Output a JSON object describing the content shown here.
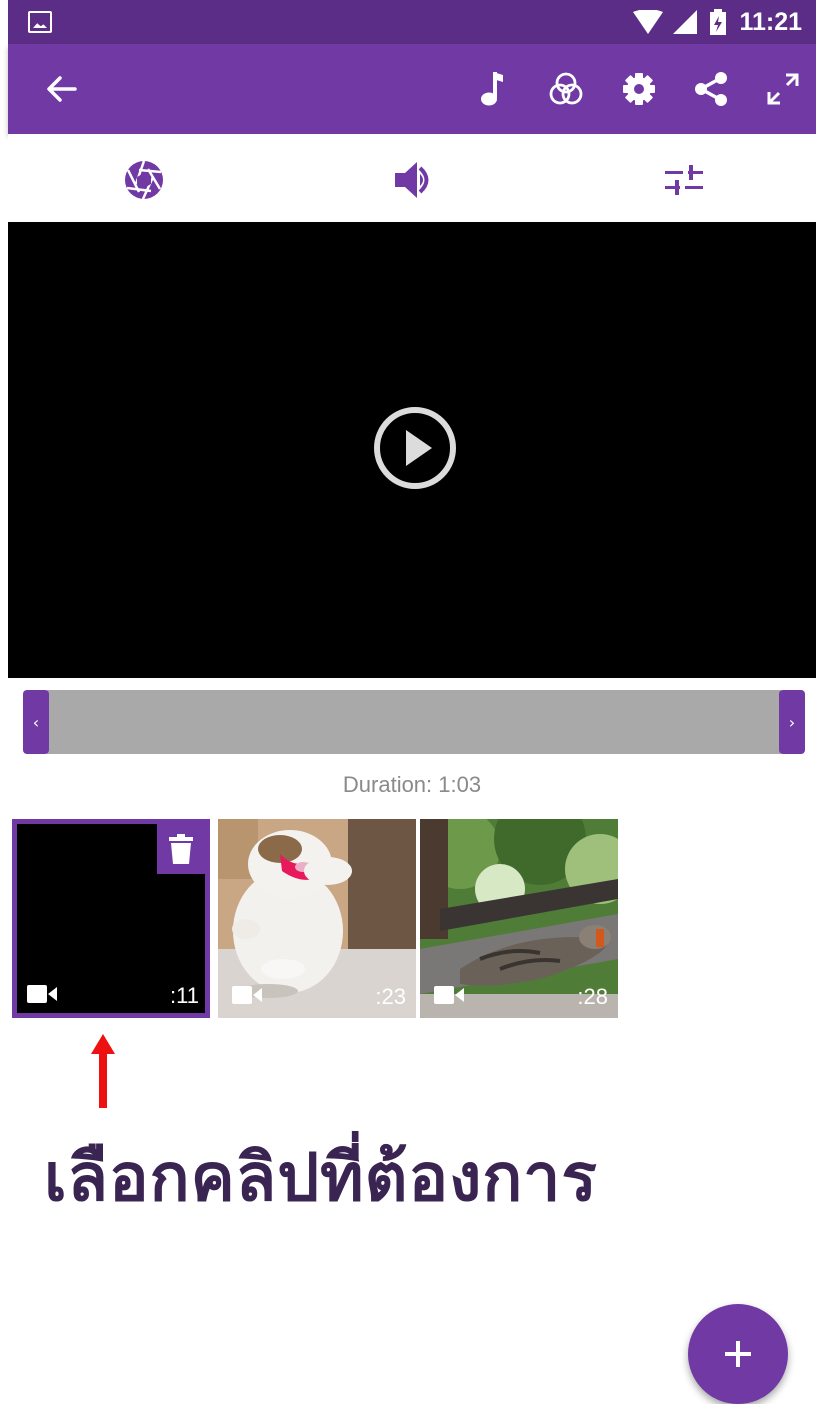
{
  "status_bar": {
    "time": "11:21"
  },
  "app_bar": {
    "icons": [
      "back-arrow-icon",
      "music-note-icon",
      "color-filter-icon",
      "settings-gear-icon",
      "share-icon",
      "fullscreen-icon"
    ]
  },
  "tool_tabs": [
    "aperture-icon",
    "volume-icon",
    "tune-sliders-icon"
  ],
  "player": {
    "state": "paused"
  },
  "scrubber": {
    "left_label": "‹",
    "right_label": "›"
  },
  "duration_text": "Duration: 1:03",
  "clips": [
    {
      "duration": ":11",
      "selected": true,
      "thumbnail": "black"
    },
    {
      "duration": ":23",
      "selected": false,
      "thumbnail": "white cat with pink bandana"
    },
    {
      "duration": ":28",
      "selected": false,
      "thumbnail": "tabby cat lying on park bench"
    }
  ],
  "annotation": {
    "text": "เลือกคลิปที่ต้องการ"
  },
  "fab": {
    "label": "+"
  },
  "colors": {
    "primary": "#7039a3",
    "status_bar": "#5c2d86",
    "annotation_text": "#3a2452",
    "arrow": "#ee1111"
  }
}
